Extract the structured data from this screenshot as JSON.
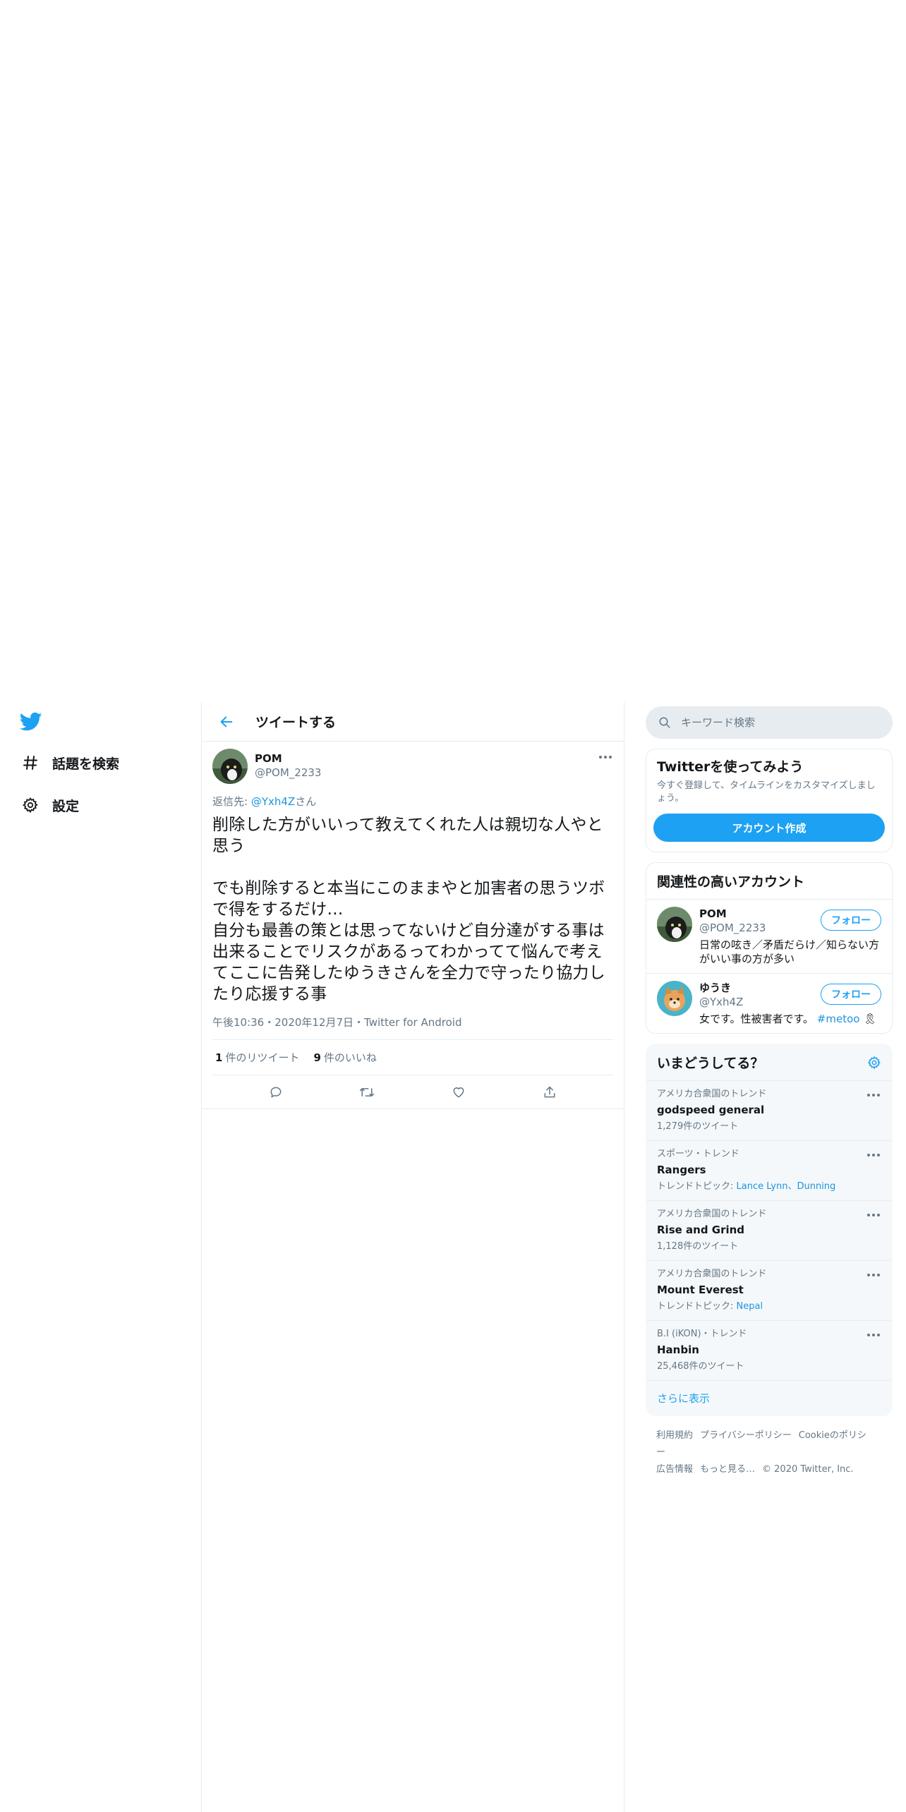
{
  "nav": {
    "items": [
      {
        "label": "話題を検索",
        "icon": "hashtag-icon"
      },
      {
        "label": "設定",
        "icon": "gear-icon"
      }
    ]
  },
  "header": {
    "title": "ツイートする"
  },
  "tweet": {
    "name": "POM",
    "handle": "@POM_2233",
    "reply_prefix": "返信先: ",
    "reply_to": "@Yxh4Z",
    "reply_suffix": "さん",
    "text": "削除した方がいいって教えてくれた人は親切な人やと思う\n\nでも削除すると本当にこのままやと加害者の思うツボで得をするだけ…\n自分も最善の策とは思ってないけど自分達がする事は出来ることでリスクがあるってわかってて悩んで考えてここに告発したゆうきさんを全力で守ったり協力したり応援する事",
    "meta": "午後10:36・2020年12月7日・Twitter for Android",
    "retweets_count": "1",
    "retweets_label": "件のリツイート",
    "likes_count": "9",
    "likes_label": "件のいいね"
  },
  "search": {
    "placeholder": "キーワード検索"
  },
  "signup": {
    "title": "Twitterを使ってみよう",
    "desc": "今すぐ登録して、タイムラインをカスタマイズしましょう。",
    "button": "アカウント作成"
  },
  "related": {
    "title": "関連性の高いアカウント",
    "follow_label": "フォロー",
    "accounts": [
      {
        "name": "POM",
        "handle": "@POM_2233",
        "bio": "日常の呟き／矛盾だらけ／知らない方がいい事の方が多い",
        "tag": ""
      },
      {
        "name": "ゆうき",
        "handle": "@Yxh4Z",
        "bio": "女です。性被害者です。",
        "tag": "#metoo"
      }
    ]
  },
  "trends": {
    "title": "いまどうしてる？",
    "items": [
      {
        "context": "アメリカ合衆国のトレンド",
        "name": "godspeed general",
        "sub": "1,279件のツイート",
        "link": ""
      },
      {
        "context": "スポーツ・トレンド",
        "name": "Rangers",
        "sub": "トレンドトピック: ",
        "link": "Lance Lynn、Dunning"
      },
      {
        "context": "アメリカ合衆国のトレンド",
        "name": "Rise and Grind",
        "sub": "1,128件のツイート",
        "link": ""
      },
      {
        "context": "アメリカ合衆国のトレンド",
        "name": "Mount Everest",
        "sub": "トレンドトピック: ",
        "link": "Nepal"
      },
      {
        "context": "B.I (iKON)・トレンド",
        "name": "Hanbin",
        "sub": "25,468件のツイート",
        "link": ""
      }
    ],
    "show_more": "さらに表示"
  },
  "footer": {
    "links": [
      "利用規約",
      "プライバシーポリシー",
      "Cookieのポリシー",
      "広告情報",
      "もっと見る…"
    ],
    "copyright": "© 2020 Twitter, Inc."
  },
  "colors": {
    "accent": "#1da1f2",
    "link": "#1b95e0",
    "muted": "#657786",
    "border": "#e6ecf0"
  }
}
